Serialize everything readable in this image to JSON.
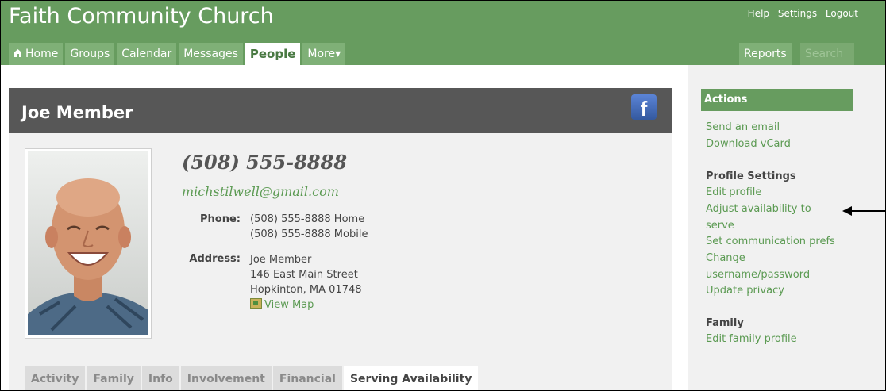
{
  "header": {
    "church_name": "Faith Community Church",
    "util_links": [
      "Help",
      "Settings",
      "Logout"
    ],
    "tabs": [
      {
        "label": "Home",
        "icon": "home-icon"
      },
      {
        "label": "Groups"
      },
      {
        "label": "Calendar"
      },
      {
        "label": "Messages"
      },
      {
        "label": "People",
        "active": true
      },
      {
        "label": "More▾"
      }
    ],
    "reports_label": "Reports",
    "search_label": "Search"
  },
  "profile": {
    "name": "Joe Member",
    "facebook_glyph": "f",
    "big_phone": "(508) 555-8888",
    "email": "michstilwell@gmail.com",
    "phone_label": "Phone:",
    "phones": [
      "(508) 555-8888 Home",
      "(508) 555-8888 Mobile"
    ],
    "address_label": "Address:",
    "address_lines": [
      "Joe Member",
      "146 East Main Street",
      "Hopkinton, MA 01748"
    ],
    "view_map": "View Map",
    "subtabs": [
      "Activity",
      "Family",
      "Info",
      "Involvement",
      "Financial",
      "Serving Availability"
    ],
    "active_subtab": "Serving Availability"
  },
  "sidebar": {
    "actions_title": "Actions",
    "actions": [
      "Send an email",
      "Download vCard"
    ],
    "profile_settings_title": "Profile Settings",
    "profile_settings": [
      "Edit profile",
      "Adjust availability to serve",
      "Set communication prefs",
      "Change username/password",
      "Update privacy"
    ],
    "family_title": "Family",
    "family_links": [
      "Edit family profile"
    ]
  },
  "colors": {
    "brand_green": "#679c5f",
    "tab_green": "#7fb077",
    "link_green": "#5b9a52",
    "name_bar": "#575757"
  }
}
